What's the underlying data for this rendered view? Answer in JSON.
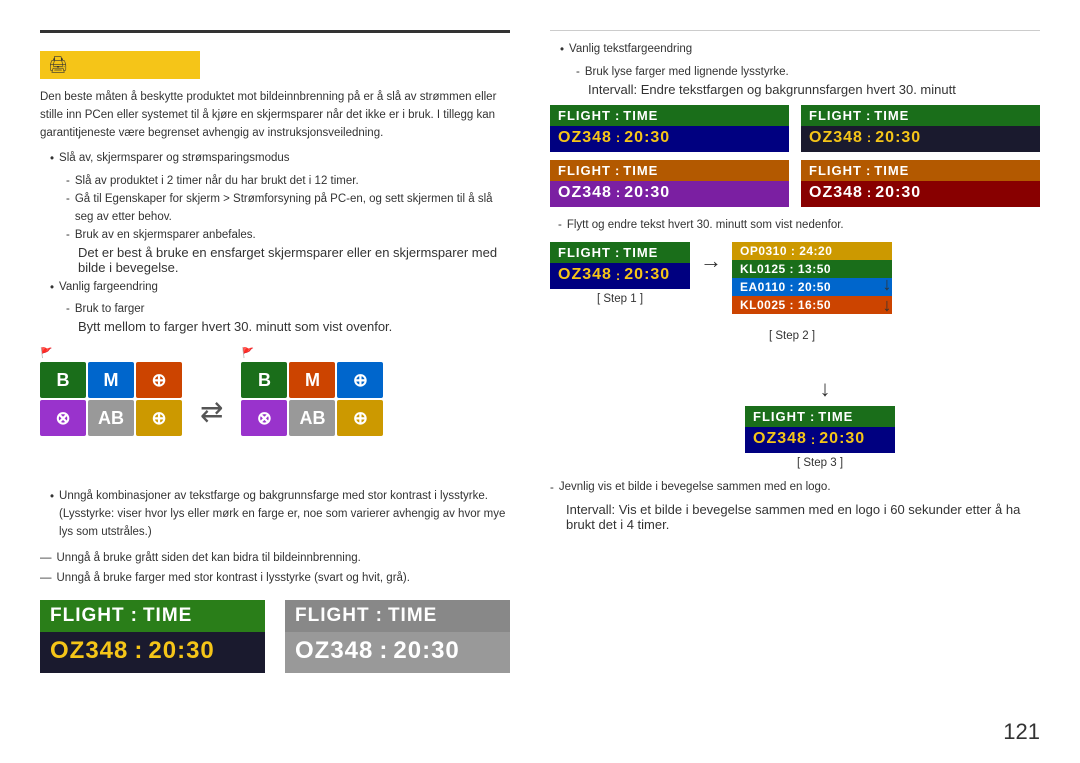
{
  "page": {
    "number": "121"
  },
  "left": {
    "warning_icon": "🖨",
    "body_text_1": "Den beste måten å beskytte produktet mot bildeinnbrenning på er å slå av strømmen eller stille inn PCen eller systemet til å kjøre en skjermsparer når det ikke er i bruk. I tillegg kan garantitjeneste være begrenset avhengig av instruksjonsveiledning.",
    "bullet1_label": "Slå av, skjermsparer og strømsparingsmodus",
    "sub1_1": "Slå av produktet i 2 timer når du har brukt det i 12 timer.",
    "sub1_2": "Gå til Egenskaper for skjerm > Strømforsyning på PC-en, og sett skjermen til å slå seg av etter behov.",
    "sub1_3": "Bruk av en skjermsparer anbefales.",
    "sub1_3b": "Det er best å bruke en ensfarget skjermsparer eller en skjermsparer med bilde i bevegelse.",
    "bullet2_label": "Vanlig fargeendring",
    "sub2_1": "Bruk to farger",
    "sub2_1b": "Bytt mellom to farger hvert 30. minutt som vist ovenfor.",
    "avoid1": "Unngå kombinasjoner av tekstfarge og bakgrunnsfarge med stor kontrast i lysstyrke.",
    "avoid1b": "(Lysstyrke: viser hvor lys eller mørk en farge er, noe som varierer avhengig av hvor mye lys som utstråles.)",
    "avoid2": "Unngå å bruke grått siden det kan bidra til bildeinnbrenning.",
    "avoid3": "Unngå å bruke farger med stor kontrast i lysstyrke (svart og hvit, grå).",
    "grid1_flag": "🚩",
    "grid2_flag": "🚩",
    "arrow": "⇄",
    "flight_dark": {
      "header_bg": "#222",
      "header_title_bg": "#2a7e19",
      "header_title": "FLIGHT",
      "header_colon": ":",
      "header_word": "TIME",
      "body_bg": "#1a1a2e",
      "value_color": "#f5c518",
      "value": "OZ348",
      "colon": ":",
      "time": "20:30"
    },
    "flight_gray": {
      "header_bg": "#666",
      "header_title_bg": "#888",
      "header_title": "FLIGHT",
      "header_colon": ":",
      "header_word": "TIME",
      "body_bg": "#999",
      "value_color": "#fff",
      "value": "OZ348",
      "colon": ":",
      "time": "20:30"
    }
  },
  "right": {
    "note1": "Vanlig tekstfargeendring",
    "note1_dash": "Bruk lyse farger med lignende lysstyrke.",
    "note1_dash2": "Intervall: Endre tekstfargen og bakgrunnsfargen hvert 30. minutt",
    "displays_row1": [
      {
        "header_bg": "#1a6e1a",
        "header_title": "FLIGHT",
        "header_colon": ":",
        "header_word": "TIME",
        "body_bg": "#000080",
        "value": "OZ348",
        "colon": ":",
        "time": "20:30",
        "value_color": "#f5c518"
      },
      {
        "header_bg": "#1a6e1a",
        "header_title": "FLIGHT",
        "header_colon": ":",
        "header_word": "TIME",
        "body_bg": "#1a1a2e",
        "value": "OZ348",
        "colon": ":",
        "time": "20:30",
        "value_color": "#f5c518"
      }
    ],
    "displays_row2": [
      {
        "header_bg": "#b35900",
        "header_title": "FLIGHT",
        "header_colon": ":",
        "header_word": "TIME",
        "body_bg": "#7b1fa2",
        "value": "OZ348",
        "colon": ":",
        "time": "20:30",
        "value_color": "#fff"
      },
      {
        "header_bg": "#b35900",
        "header_title": "FLIGHT",
        "header_colon": ":",
        "header_word": "TIME",
        "body_bg": "#880000",
        "value": "OZ348",
        "colon": ":",
        "time": "20:30",
        "value_color": "#fff"
      }
    ],
    "step_note": "Flytt og endre tekst hvert 30. minutt som vist nedenfor.",
    "step1_label": "[ Step 1 ]",
    "step2_label": "[ Step 2 ]",
    "step3_label": "[ Step 3 ]",
    "step1_display": {
      "header_bg": "#1a6e1a",
      "header_title": "FLIGHT",
      "header_colon": ":",
      "header_word": "TIME",
      "body_bg": "#000080",
      "value": "OZ348",
      "colon": ":",
      "time": "20:30",
      "value_color": "#f5c518"
    },
    "step2_rows": [
      {
        "bg": "#cc9900",
        "text": "OP0310 : 24:20"
      },
      {
        "bg": "#1a6e1a",
        "text": "KL0125 : 13:50"
      },
      {
        "bg": "#0066cc",
        "text": "EA0110 : 20:50"
      },
      {
        "bg": "#cc4400",
        "text": "KL0025 : 16:50"
      }
    ],
    "step3_display": {
      "header_bg": "#1a6e1a",
      "header_title": "FLIGHT",
      "header_colon": ":",
      "header_word": "TIME",
      "body_bg": "#000080",
      "value": "OZ348",
      "colon": ":",
      "time": "20:30",
      "value_color": "#f5c518"
    },
    "bottom_note1": "Jevnlig vis et bilde i bevegelse sammen med en logo.",
    "bottom_note2": "Intervall: Vis et bilde i bevegelse sammen med en logo i 60 sekunder etter å ha brukt det i 4 timer."
  },
  "color_grid": {
    "cells_left": [
      {
        "bg": "#1a6e1a",
        "symbol": "B"
      },
      {
        "bg": "#0066cc",
        "symbol": "M"
      },
      {
        "bg": "#cc4400",
        "symbol": "⊕"
      },
      {
        "bg": "#9933cc",
        "symbol": "⊗"
      },
      {
        "bg": "#999",
        "symbol": "AB"
      },
      {
        "bg": "#cc9900",
        "symbol": "⊕"
      }
    ],
    "cells_right": [
      {
        "bg": "#1a6e1a",
        "symbol": "B"
      },
      {
        "bg": "#cc4400",
        "symbol": "M"
      },
      {
        "bg": "#0066cc",
        "symbol": "⊕"
      },
      {
        "bg": "#9933cc",
        "symbol": "⊗"
      },
      {
        "bg": "#999",
        "symbol": "AB"
      },
      {
        "bg": "#cc9900",
        "symbol": "⊕"
      }
    ]
  }
}
